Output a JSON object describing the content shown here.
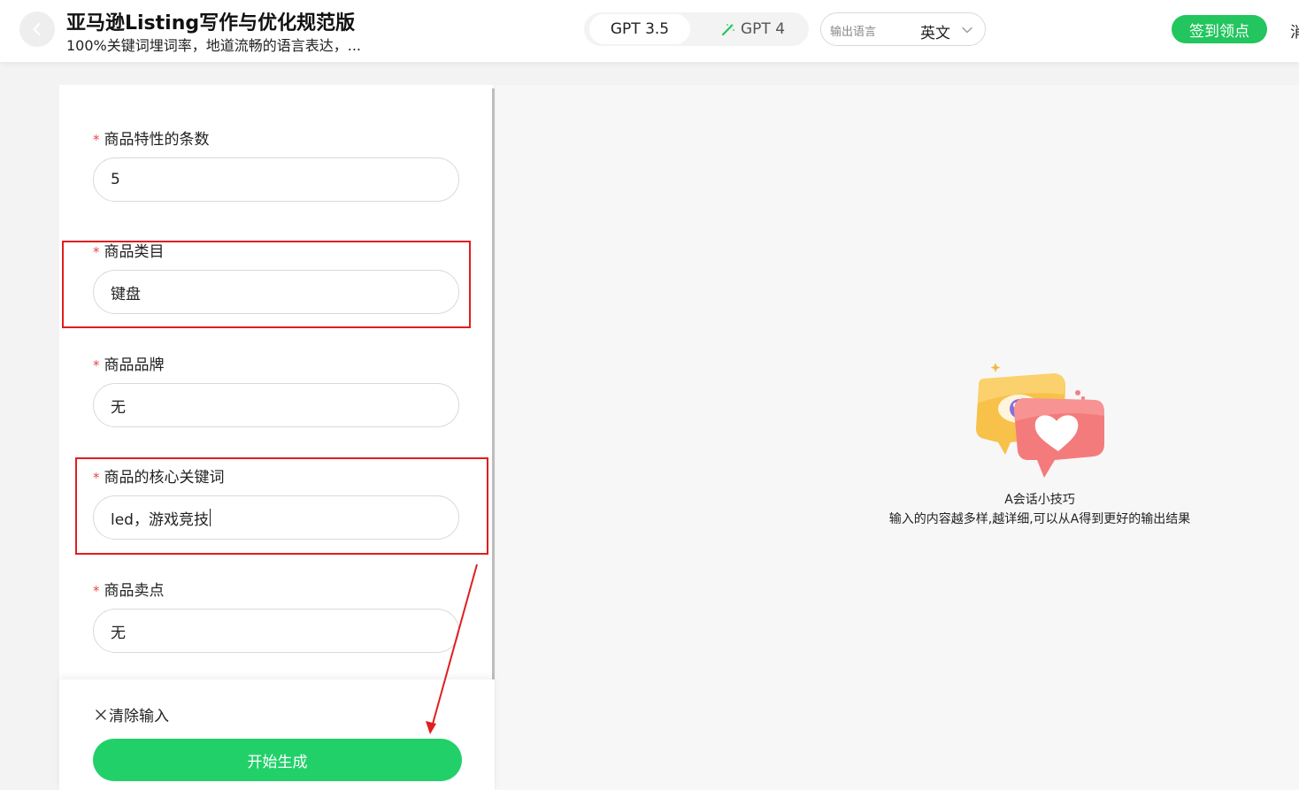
{
  "header": {
    "title": "亚马逊Listing写作与优化规范版",
    "subtitle": "100%关键词埋词率，地道流畅的语言表达，...",
    "models": [
      {
        "label": "GPT 3.5",
        "selected": true
      },
      {
        "label": "GPT 4",
        "selected": false
      }
    ],
    "language": {
      "label": "输出语言",
      "value": "英文"
    },
    "signin_label": "签到领点",
    "edge_text": "消"
  },
  "form": {
    "fields": [
      {
        "label": "商品特性的条数",
        "value": "5"
      },
      {
        "label": "商品类目",
        "value": "键盘"
      },
      {
        "label": "商品品牌",
        "value": "无"
      },
      {
        "label": "商品的核心关键词",
        "value": "led，游戏竞技"
      },
      {
        "label": "商品卖点",
        "value": "无"
      }
    ],
    "required_mark": "*",
    "clear_label": "清除输入",
    "generate_label": "开始生成"
  },
  "empty_state": {
    "title": "A会话小技巧",
    "text": "输入的内容越多样,越详细,可以从A得到更好的输出结果"
  },
  "colors": {
    "accent_green": "#22c55e",
    "annotation_red": "#e01e1e",
    "required_red": "#e5484d"
  }
}
